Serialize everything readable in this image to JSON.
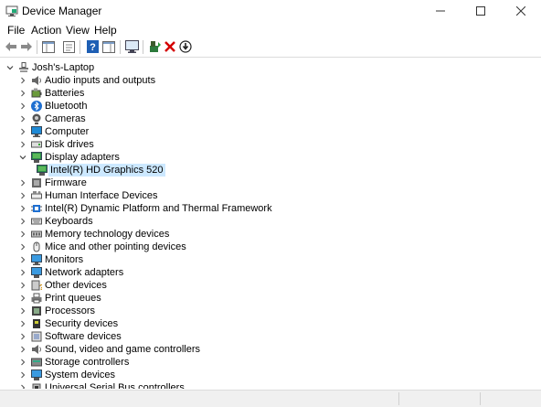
{
  "window": {
    "title": "Device Manager",
    "accent": "#0078d7"
  },
  "menu": [
    "File",
    "Action",
    "View",
    "Help"
  ],
  "toolbar": {
    "buttons": [
      "back-arrow-icon",
      "forward-arrow-icon",
      "console-tree-icon",
      "properties-icon",
      "help-icon",
      "action-pane-icon",
      "monitor-icon",
      "update-driver-icon",
      "uninstall-icon",
      "download-icon"
    ]
  },
  "tree": {
    "root": "Josh's-Laptop",
    "items": [
      {
        "label": "Audio inputs and outputs",
        "icon": "speaker-icon",
        "expanded": false
      },
      {
        "label": "Batteries",
        "icon": "battery-icon",
        "expanded": false
      },
      {
        "label": "Bluetooth",
        "icon": "bluetooth-icon",
        "expanded": false
      },
      {
        "label": "Cameras",
        "icon": "camera-icon",
        "expanded": false
      },
      {
        "label": "Computer",
        "icon": "computer-icon",
        "expanded": false
      },
      {
        "label": "Disk drives",
        "icon": "disk-drive-icon",
        "expanded": false
      },
      {
        "label": "Display adapters",
        "icon": "display-adapter-icon",
        "expanded": true
      },
      {
        "label": "Intel(R) HD Graphics 520",
        "icon": "display-adapter-icon",
        "child": true,
        "selected": true
      },
      {
        "label": "Firmware",
        "icon": "firmware-icon",
        "expanded": false
      },
      {
        "label": "Human Interface Devices",
        "icon": "hid-icon",
        "expanded": false
      },
      {
        "label": "Intel(R) Dynamic Platform and Thermal Framework",
        "icon": "chip-icon",
        "expanded": false
      },
      {
        "label": "Keyboards",
        "icon": "keyboard-icon",
        "expanded": false
      },
      {
        "label": "Memory technology devices",
        "icon": "memory-icon",
        "expanded": false
      },
      {
        "label": "Mice and other pointing devices",
        "icon": "mouse-icon",
        "expanded": false
      },
      {
        "label": "Monitors",
        "icon": "monitor-icon",
        "expanded": false
      },
      {
        "label": "Network adapters",
        "icon": "network-icon",
        "expanded": false
      },
      {
        "label": "Other devices",
        "icon": "unknown-device-icon",
        "expanded": false
      },
      {
        "label": "Print queues",
        "icon": "printer-icon",
        "expanded": false
      },
      {
        "label": "Processors",
        "icon": "processor-icon",
        "expanded": false
      },
      {
        "label": "Security devices",
        "icon": "security-device-icon",
        "expanded": false
      },
      {
        "label": "Software devices",
        "icon": "software-device-icon",
        "expanded": false
      },
      {
        "label": "Sound, video and game controllers",
        "icon": "sound-icon",
        "expanded": false
      },
      {
        "label": "Storage controllers",
        "icon": "storage-icon",
        "expanded": false
      },
      {
        "label": "System devices",
        "icon": "system-device-icon",
        "expanded": false
      },
      {
        "label": "Universal Serial Bus controllers",
        "icon": "usb-icon",
        "expanded": false
      }
    ]
  },
  "colors": {
    "selection": "#cce8ff",
    "delete_red": "#d40000",
    "help_blue": "#1e5fb4"
  }
}
